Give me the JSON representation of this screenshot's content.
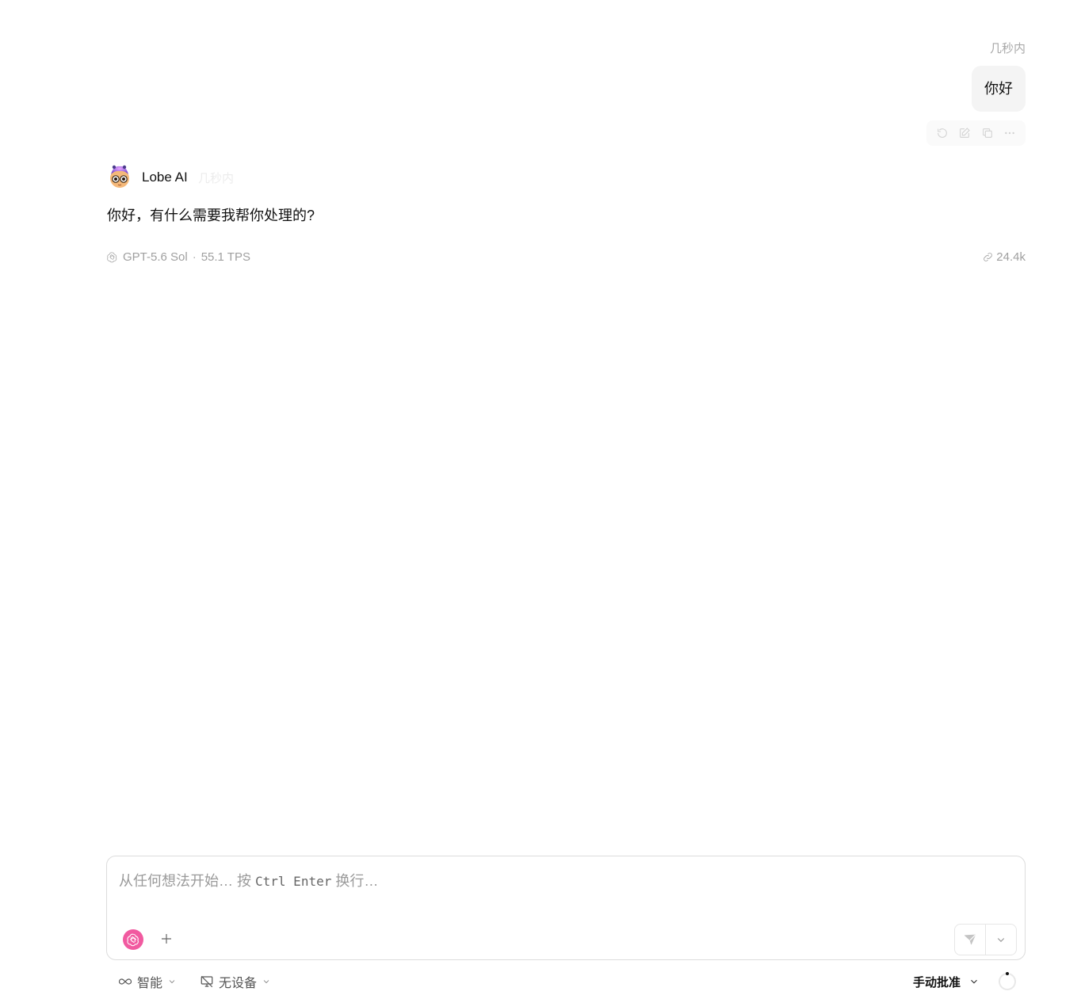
{
  "user_message": {
    "time": "几秒内",
    "text": "你好",
    "actions": [
      "regenerate-icon",
      "edit-icon",
      "copy-icon",
      "more-icon"
    ]
  },
  "assistant_message": {
    "name": "Lobe AI",
    "time": "几秒内",
    "text": "你好，有什么需要我帮你处理的?",
    "model": "GPT-5.6 Sol",
    "separator": "·",
    "tps": "55.1 TPS",
    "tokens": "24.4k"
  },
  "composer": {
    "placeholder_main": "从任何想法开始… 按 ",
    "placeholder_key": "Ctrl Enter",
    "placeholder_end": " 换行…",
    "model_icon": "openai-icon",
    "accent": "#f15aa0"
  },
  "bottom_bar": {
    "mode_label": "智能",
    "device_label": "无设备",
    "approval_label": "手动批准"
  }
}
